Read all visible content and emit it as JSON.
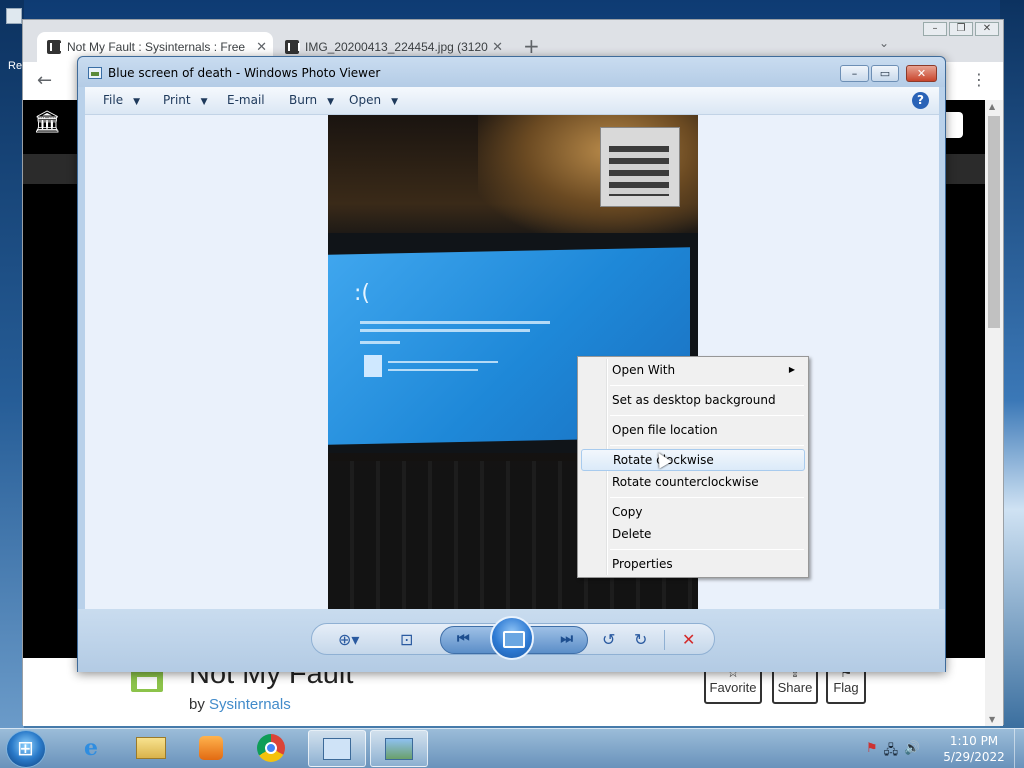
{
  "desktop": {
    "left_label": "Re"
  },
  "browser": {
    "tabs": [
      {
        "title": "Not My Fault : Sysinternals : Free",
        "close": "✕"
      },
      {
        "title": "IMG_20200413_224454.jpg (3120",
        "close": "✕"
      }
    ],
    "new_tab": "+",
    "tab_dropdown": "⌄",
    "window_controls": [
      "–",
      "❐",
      "✕"
    ],
    "back": "←",
    "menu": "⋮",
    "page": {
      "site_initials": "I",
      "item_title": "Not My Fault",
      "by_prefix": "by ",
      "by_author": "Sysinternals",
      "actions": [
        {
          "icon": "☆",
          "label": "Favorite"
        },
        {
          "icon": "⇪",
          "label": "Share"
        },
        {
          "icon": "⚑",
          "label": "Flag"
        }
      ]
    }
  },
  "photo_viewer": {
    "title": "Blue screen of death - Windows Photo Viewer",
    "window_controls": {
      "minimize": "–",
      "maximize": "▭",
      "close": "✕"
    },
    "menu": [
      {
        "label": "File",
        "arrow": "▼"
      },
      {
        "label": "Print",
        "arrow": "▼"
      },
      {
        "label": "E-mail",
        "arrow": ""
      },
      {
        "label": "Burn",
        "arrow": "▼"
      },
      {
        "label": "Open",
        "arrow": "▼"
      }
    ],
    "help": "?",
    "photo": {
      "sad_face": ":("
    },
    "controls": {
      "zoom": "⊕▾",
      "fit": "⊡",
      "previous": "⏮",
      "next": "⏭",
      "rotate_ccw": "↺",
      "rotate_cw": "↻",
      "delete": "✕"
    }
  },
  "context_menu": {
    "items": [
      {
        "label": "Open With",
        "submenu": "▶"
      },
      {
        "label": "Set as desktop background"
      },
      {
        "label": "Open file location"
      },
      {
        "label": "Rotate clockwise",
        "highlighted": true
      },
      {
        "label": "Rotate counterclockwise"
      },
      {
        "label": "Copy"
      },
      {
        "label": "Delete"
      },
      {
        "label": "Properties"
      }
    ]
  },
  "taskbar": {
    "ie_glyph": "e",
    "tray_icons": [
      "flag-icon",
      "network-icon",
      "volume-icon"
    ],
    "time": "1:10 PM",
    "date": "5/29/2022"
  },
  "colors": {
    "photo_viewer_chrome": "#b9d1ea",
    "bsod_blue": "#1e88d8",
    "delete_red": "#d42a2a",
    "link_blue": "#428bca"
  }
}
